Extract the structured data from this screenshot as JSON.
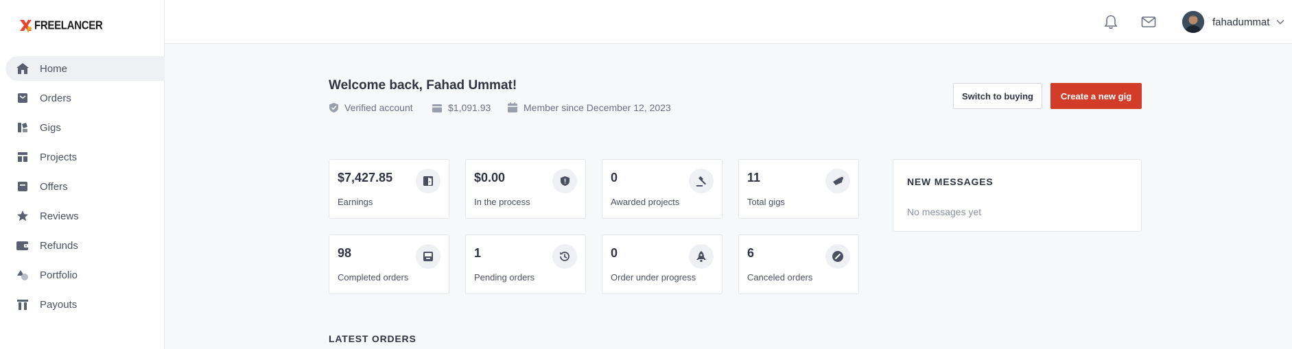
{
  "brand": {
    "name": "FREELANCER",
    "mark": "X",
    "mark_sub": "p"
  },
  "sidebar": {
    "items": [
      {
        "label": "Home",
        "icon": "home-icon",
        "active": true
      },
      {
        "label": "Orders",
        "icon": "orders-icon"
      },
      {
        "label": "Gigs",
        "icon": "gigs-icon"
      },
      {
        "label": "Projects",
        "icon": "projects-icon"
      },
      {
        "label": "Offers",
        "icon": "offers-icon"
      },
      {
        "label": "Reviews",
        "icon": "star-icon"
      },
      {
        "label": "Refunds",
        "icon": "wallet-icon"
      },
      {
        "label": "Portfolio",
        "icon": "shapes-icon"
      },
      {
        "label": "Payouts",
        "icon": "payouts-icon"
      }
    ]
  },
  "topbar": {
    "notifications_icon": "bell-icon",
    "messages_icon": "mail-icon",
    "username": "fahadummat"
  },
  "header": {
    "welcome": "Welcome back, Fahad Ummat!",
    "verified": "Verified account",
    "balance": "$1,091.93",
    "member_since": "Member since December 12, 2023",
    "switch_button": "Switch to buying",
    "create_button": "Create a new gig"
  },
  "stats": [
    {
      "value": "$7,427.85",
      "label": "Earnings",
      "icon": "wallet-door-icon"
    },
    {
      "value": "$0.00",
      "label": "In the process",
      "icon": "shield-icon"
    },
    {
      "value": "0",
      "label": "Awarded projects",
      "icon": "gavel-icon"
    },
    {
      "value": "11",
      "label": "Total gigs",
      "icon": "bullhorn-icon"
    },
    {
      "value": "98",
      "label": "Completed orders",
      "icon": "archive-icon"
    },
    {
      "value": "1",
      "label": "Pending orders",
      "icon": "history-icon"
    },
    {
      "value": "0",
      "label": "Order under progress",
      "icon": "rocket-icon"
    },
    {
      "value": "6",
      "label": "Canceled orders",
      "icon": "cancel-icon"
    }
  ],
  "messages": {
    "title": "NEW MESSAGES",
    "empty": "No messages yet"
  },
  "latest_orders": {
    "title": "LATEST ORDERS"
  },
  "colors": {
    "accent": "#d23c28",
    "sidebar_active": "#eef0f4",
    "page_bg": "#f7f8fa"
  }
}
